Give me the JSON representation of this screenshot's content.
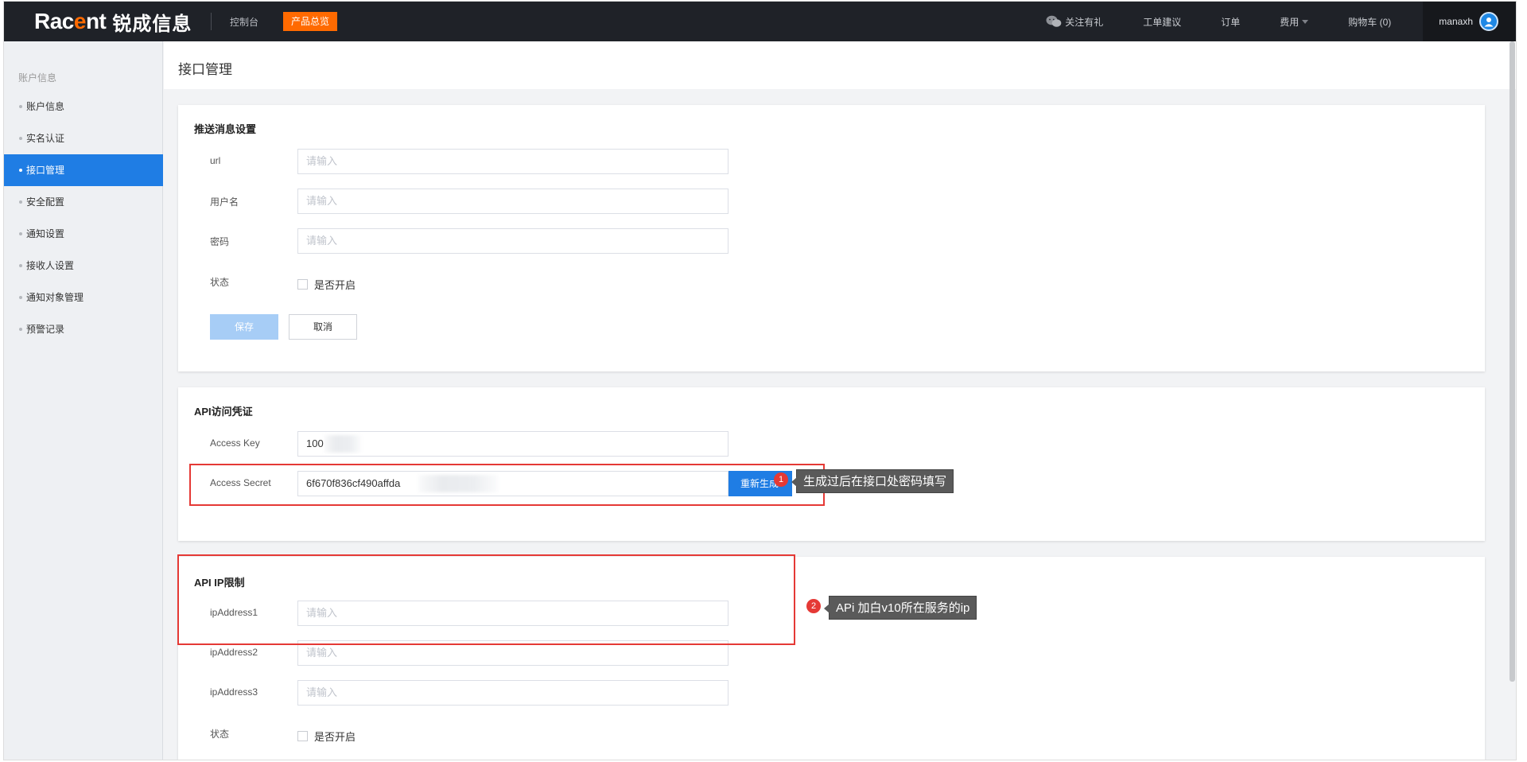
{
  "topbar": {
    "logo_word_a": "Rac",
    "logo_word_b": "e",
    "logo_word_c": "nt",
    "logo_cn": "锐成信息",
    "console": "控制台",
    "products": "产品总览",
    "follow": "关注有礼",
    "ticket": "工单建议",
    "orders": "订单",
    "fees": "费用",
    "cart": "购物车 (0)",
    "username": "manaxh"
  },
  "sidebar": {
    "title": "账户信息",
    "items": [
      {
        "label": "账户信息"
      },
      {
        "label": "实名认证"
      },
      {
        "label": "接口管理"
      },
      {
        "label": "安全配置"
      },
      {
        "label": "通知设置"
      },
      {
        "label": "接收人设置"
      },
      {
        "label": "通知对象管理"
      },
      {
        "label": "预警记录"
      }
    ]
  },
  "page": {
    "title": "接口管理"
  },
  "push": {
    "title": "推送消息设置",
    "url_label": "url",
    "url_placeholder": "请输入",
    "user_label": "用户名",
    "user_placeholder": "请输入",
    "pwd_label": "密码",
    "pwd_placeholder": "请输入",
    "status_label": "状态",
    "enable_label": "是否开启",
    "save": "保存",
    "cancel": "取消"
  },
  "api": {
    "title": "API访问凭证",
    "key_label": "Access Key",
    "key_value": "100",
    "secret_label": "Access Secret",
    "secret_value": "6f670f836cf490affda",
    "regen": "重新生成"
  },
  "ip": {
    "title": "API IP限制",
    "ip1_label": "ipAddress1",
    "ip1_placeholder": "请输入",
    "ip2_label": "ipAddress2",
    "ip2_placeholder": "请输入",
    "ip3_label": "ipAddress3",
    "ip3_placeholder": "请输入",
    "status_label": "状态",
    "enable_label": "是否开启"
  },
  "annotations": {
    "badge1": "1",
    "tip1": "生成过后在接口处密码填写",
    "badge2": "2",
    "tip2": "APi 加白v10所在服务的ip"
  },
  "colors": {
    "topbar_bg": "#1f2228",
    "brand_orange": "#ff6a00",
    "primary_blue": "#1f7de4",
    "annotation_red": "#e53935"
  }
}
